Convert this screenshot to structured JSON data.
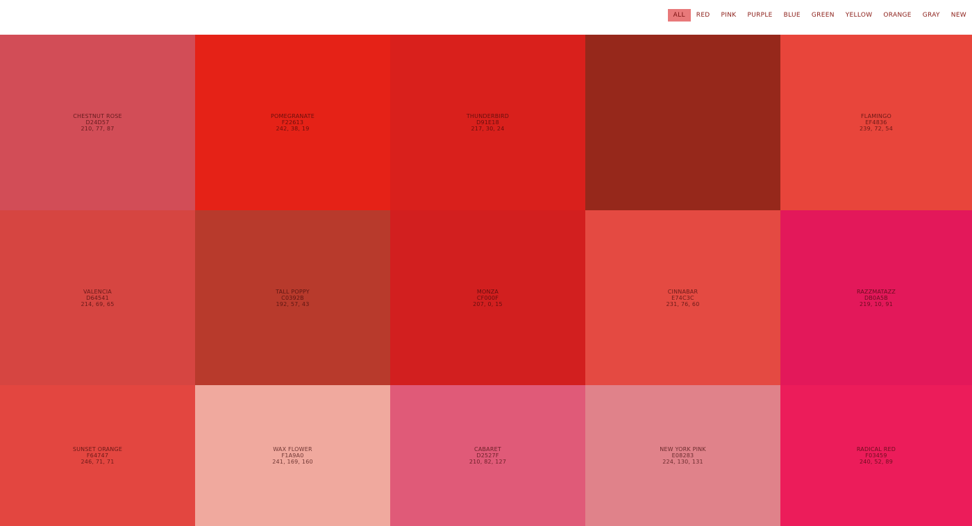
{
  "nav": {
    "filters": [
      {
        "label": "ALL",
        "active": true
      },
      {
        "label": "RED",
        "active": false
      },
      {
        "label": "PINK",
        "active": false
      },
      {
        "label": "PURPLE",
        "active": false
      },
      {
        "label": "BLUE",
        "active": false
      },
      {
        "label": "GREEN",
        "active": false
      },
      {
        "label": "YELLOW",
        "active": false
      },
      {
        "label": "ORANGE",
        "active": false
      },
      {
        "label": "GRAY",
        "active": false
      },
      {
        "label": "NEW",
        "active": false
      }
    ]
  },
  "swatches": [
    {
      "name": "CHESTNUT ROSE",
      "hex": "D24D57",
      "rgb": "210, 77, 87",
      "color": "#d24d57"
    },
    {
      "name": "POMEGRANATE",
      "hex": "F22613",
      "rgb": "242, 38, 19",
      "color": "#e52217"
    },
    {
      "name": "THUNDERBIRD",
      "hex": "D91E18",
      "rgb": "217, 30, 24",
      "color": "#d9201c"
    },
    {
      "name": "",
      "hex": "",
      "rgb": "",
      "color": "#96281b"
    },
    {
      "name": "FLAMINGO",
      "hex": "EF4836",
      "rgb": "239, 72, 54",
      "color": "#e8453b"
    },
    {
      "name": "VALENCIA",
      "hex": "D64541",
      "rgb": "214, 69, 65",
      "color": "#d64541"
    },
    {
      "name": "TALL POPPY",
      "hex": "C0392B",
      "rgb": "192, 57, 43",
      "color": "#b83a2c"
    },
    {
      "name": "MONZA",
      "hex": "CF000F",
      "rgb": "207, 0, 15",
      "color": "#d21f1f"
    },
    {
      "name": "CINNABAR",
      "hex": "E74C3C",
      "rgb": "231, 76, 60",
      "color": "#e44a42"
    },
    {
      "name": "RAZZMATAZZ",
      "hex": "DB0A5B",
      "rgb": "219, 10, 91",
      "color": "#e3185a"
    },
    {
      "name": "SUNSET ORANGE",
      "hex": "F64747",
      "rgb": "246, 71, 71",
      "color": "#e34640"
    },
    {
      "name": "WAX FLOWER",
      "hex": "F1A9A0",
      "rgb": "241, 169, 160",
      "color": "#f0a99e"
    },
    {
      "name": "CABARET",
      "hex": "D2527F",
      "rgb": "210, 82, 127",
      "color": "#e05a78"
    },
    {
      "name": "NEW YORK PINK",
      "hex": "E08283",
      "rgb": "224, 130, 131",
      "color": "#e0828a"
    },
    {
      "name": "RADICAL RED",
      "hex": "F03459",
      "rgb": "240, 52, 89",
      "color": "#ec1c5a"
    }
  ]
}
